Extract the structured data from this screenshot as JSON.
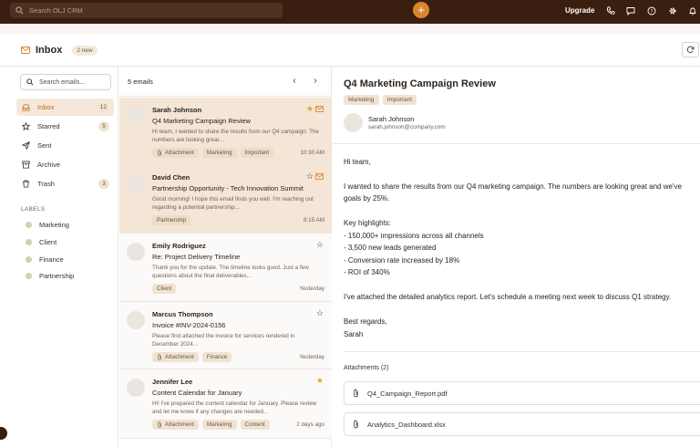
{
  "topbar": {
    "search_placeholder": "Search OLJ CRM",
    "plus_label": "+",
    "upgrade_label": "Upgrade",
    "icons": [
      "phone-icon",
      "chat-icon",
      "help-icon",
      "gear-icon",
      "bell-icon"
    ]
  },
  "header": {
    "title": "Inbox",
    "new_badge": "2 new"
  },
  "sidebar": {
    "search_placeholder": "Search emails...",
    "nav": [
      {
        "label": "Inbox",
        "count": "12",
        "icon": "inbox-icon",
        "active": true
      },
      {
        "label": "Starred",
        "count": "5",
        "icon": "star-icon"
      },
      {
        "label": "Sent",
        "count": "",
        "icon": "send-icon"
      },
      {
        "label": "Archive",
        "count": "",
        "icon": "archive-icon"
      },
      {
        "label": "Trash",
        "count": "3",
        "icon": "trash-icon"
      }
    ],
    "labels_heading": "LABELS",
    "labels": [
      "Marketing",
      "Client",
      "Finance",
      "Partnership"
    ]
  },
  "list": {
    "count_label": "5 emails",
    "emails": [
      {
        "sender": "Sarah Johnson",
        "subject": "Q4 Marketing Campaign Review",
        "snippet": "Hi team, I wanted to share the results from our Q4 campaign. The numbers are looking great...",
        "tags": [
          "Attachment",
          "Marketing",
          "Important"
        ],
        "time": "10:30 AM",
        "starred": true,
        "unread": true,
        "selected": true
      },
      {
        "sender": "David Chen",
        "subject": "Partnership Opportunity - Tech Innovation Summit",
        "snippet": "Good morning! I hope this email finds you well. I'm reaching out regarding a potential partnership...",
        "tags": [
          "Partnership"
        ],
        "time": "9:15 AM",
        "starred": false,
        "unread": true,
        "selected": true
      },
      {
        "sender": "Emily Rodriguez",
        "subject": "Re: Project Delivery Timeline",
        "snippet": "Thank you for the update. The timeline looks good. Just a few questions about the final deliverables...",
        "tags": [
          "Client"
        ],
        "time": "Yesterday",
        "starred": false
      },
      {
        "sender": "Marcus Thompson",
        "subject": "Invoice #INV-2024-0156",
        "snippet": "Please find attached the invoice for services rendered in December 2024...",
        "tags": [
          "Attachment",
          "Finance"
        ],
        "time": "Yesterday",
        "starred": false
      },
      {
        "sender": "Jennifer Lee",
        "subject": "Content Calendar for January",
        "snippet": "Hi! I've prepared the content calendar for January. Please review and let me know if any changes are needed...",
        "tags": [
          "Attachment",
          "Marketing",
          "Content"
        ],
        "time": "2 days ago",
        "starred": true
      }
    ]
  },
  "detail": {
    "title": "Q4 Marketing Campaign Review",
    "tags": [
      "Marketing",
      "Important"
    ],
    "from_name": "Sarah Johnson",
    "from_email": "sarah.johnson@company.com",
    "body": [
      "Hi team,",
      "I wanted to share the results from our Q4 marketing campaign. The numbers are looking great and we've",
      "goals by 25%.",
      "Key highlights:",
      "- 150,000+ impressions across all channels",
      "- 3,500 new leads generated",
      "- Conversion rate increased by 18%",
      "- ROI of 340%",
      "I've attached the detailed analytics report. Let's schedule a meeting next week to discuss Q1 strategy.",
      "Best regards,",
      "Sarah"
    ],
    "attachments_heading": "Attachments (2)",
    "attachments": [
      "Q4_Campaign_Report.pdf",
      "Analytics_Dashboard.xlsx"
    ]
  },
  "colors": {
    "topbar_bg": "#3a1e0f",
    "accent": "#d9862d",
    "selected_row": "#f4e5d6",
    "star": "#e6a22c"
  }
}
